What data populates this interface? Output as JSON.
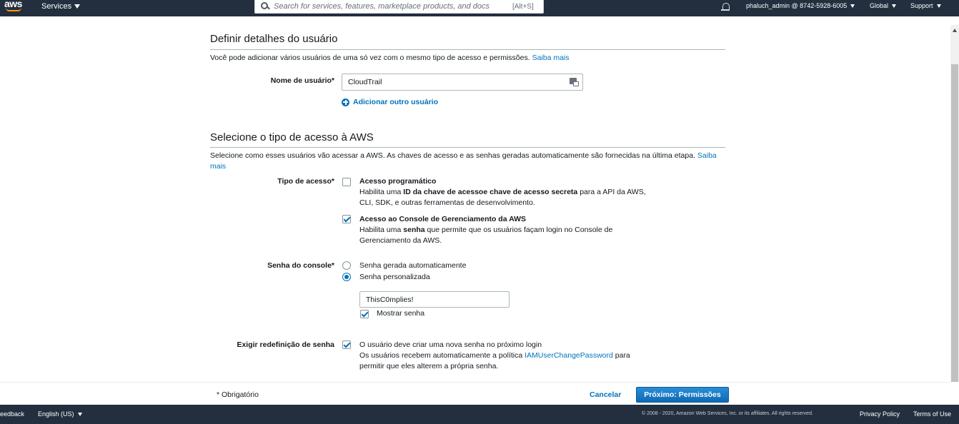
{
  "topnav": {
    "logo": "aws",
    "services_label": "Services",
    "search_placeholder": "Search for services, features, marketplace products, and docs",
    "search_shortcut": "[Alt+S]",
    "account": "phaluch_admin @ 8742-5928-6005",
    "region": "Global",
    "support": "Support"
  },
  "user_details": {
    "title": "Definir detalhes do usuário",
    "description": "Você pode adicionar vários usuários de uma só vez com o mesmo tipo de acesso e permissões.",
    "learn_more": "Saiba mais",
    "username_label": "Nome de usuário*",
    "username_value": "CloudTrail",
    "add_user": "Adicionar outro usuário"
  },
  "access_type": {
    "title": "Selecione o tipo de acesso à AWS",
    "description": "Selecione como esses usuários vão acessar a AWS. As chaves de acesso e as senhas geradas automaticamente são fornecidas na última etapa.",
    "learn_more_1": "Saiba",
    "learn_more_2": "mais",
    "label": "Tipo de acesso*",
    "programmatic": {
      "title": "Acesso programático",
      "line1_a": "Habilita uma ",
      "line1_b": "ID da chave de acessoe chave de acesso secreta",
      "line1_c": " para a API da AWS,",
      "line2": "CLI, SDK, e outras ferramentas de desenvolvimento.",
      "checked": false
    },
    "console": {
      "title": "Acesso ao Console de Gerenciamento da AWS",
      "line1_a": "Habilita uma ",
      "line1_b": "senha",
      "line1_c": " que permite que os usuários façam login no Console de",
      "line2": "Gerenciamento da AWS.",
      "checked": true
    }
  },
  "console_password": {
    "label": "Senha do console*",
    "auto": "Senha gerada automaticamente",
    "custom": "Senha personalizada",
    "selected": "custom",
    "value": "ThisC0mplies!",
    "show_password": "Mostrar senha"
  },
  "reset_password": {
    "label": "Exigir redefinição de senha",
    "line1": "O usuário deve criar uma nova senha no próximo login",
    "line2_a": "Os usuários recebem automaticamente a política ",
    "policy_link": "IAMUserChangePassword",
    "line2_c": " para",
    "line3": "permitir que eles alterem a própria senha.",
    "checked": true
  },
  "wizard_footer": {
    "required": "* Obrigatório",
    "cancel": "Cancelar",
    "next": "Próximo: Permissões"
  },
  "page_footer": {
    "feedback": "eedback",
    "language": "English (US)",
    "copyright": "© 2008 - 2020, Amazon Web Services, Inc. or its affiliates. All rights reserved.",
    "privacy": "Privacy Policy",
    "terms": "Terms of Use"
  },
  "colors": {
    "nav_bg": "#232f3e",
    "link": "#0073bb",
    "primary_button": "#0d6ab5"
  }
}
